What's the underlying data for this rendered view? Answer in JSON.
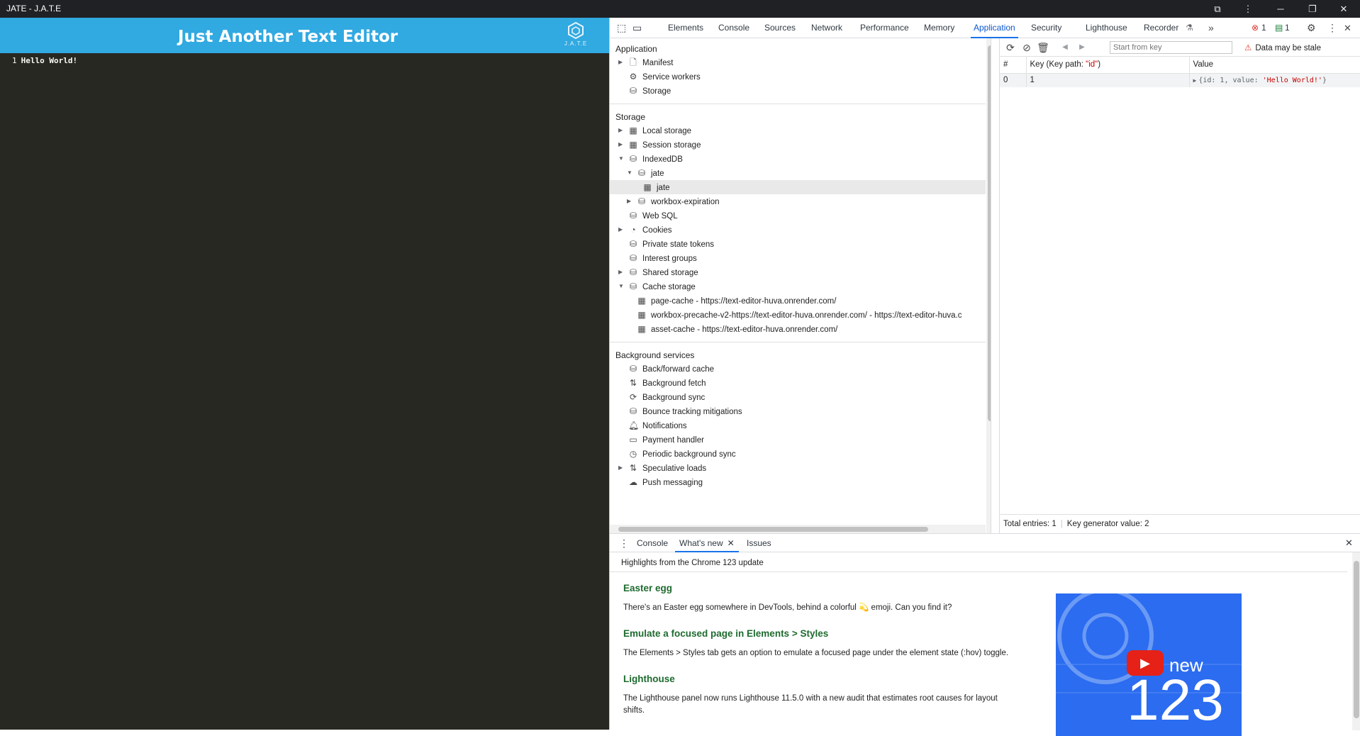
{
  "window": {
    "title": "JATE - J.A.T.E"
  },
  "app": {
    "header_title": "Just Another Text Editor",
    "logo_text": "J.A.T.E",
    "editor_line_number": "1",
    "editor_text": "Hello World!"
  },
  "devtools": {
    "tabs": [
      "Elements",
      "Console",
      "Sources",
      "Network",
      "Performance",
      "Memory",
      "Application",
      "Security",
      "Lighthouse",
      "Recorder"
    ],
    "active_tab": "Application",
    "error_count": "1",
    "message_count": "1",
    "sidebar": {
      "application_header": "Application",
      "application_items": [
        "Manifest",
        "Service workers",
        "Storage"
      ],
      "storage_header": "Storage",
      "storage_items": [
        "Local storage",
        "Session storage",
        "IndexedDB",
        "jate",
        "jate",
        "workbox-expiration",
        "Web SQL",
        "Cookies",
        "Private state tokens",
        "Interest groups",
        "Shared storage",
        "Cache storage",
        "page-cache - https://text-editor-huva.onrender.com/",
        "workbox-precache-v2-https://text-editor-huva.onrender.com/ - https://text-editor-huva.c",
        "asset-cache - https://text-editor-huva.onrender.com/"
      ],
      "background_header": "Background services",
      "background_items": [
        "Back/forward cache",
        "Background fetch",
        "Background sync",
        "Bounce tracking mitigations",
        "Notifications",
        "Payment handler",
        "Periodic background sync",
        "Speculative loads",
        "Push messaging"
      ]
    },
    "db": {
      "key_placeholder": "Start from key",
      "stale_warning": "Data may be stale",
      "col_index": "#",
      "col_key": "Key (Key path: ",
      "col_key_path": "\"id\"",
      "col_key_end": ")",
      "col_value": "Value",
      "row_index": "0",
      "row_key": "1",
      "row_value_prefix": "{id: 1, value: ",
      "row_value_string": "'Hello World!'",
      "row_value_suffix": "}",
      "footer_entries": "Total entries: 1",
      "footer_keygen": "Key generator value: 2"
    },
    "drawer": {
      "tabs": [
        "Console",
        "What's new",
        "Issues"
      ],
      "active_tab": "What's new",
      "highlights": "Highlights from the Chrome 123 update",
      "sections": [
        {
          "title": "Easter egg",
          "body": "There's an Easter egg somewhere in DevTools, behind a colorful 💫 emoji. Can you find it?"
        },
        {
          "title": "Emulate a focused page in Elements > Styles",
          "body": "The Elements > Styles tab gets an option to emulate a focused page under the element state (:hov) toggle."
        },
        {
          "title": "Lighthouse",
          "body": "The Lighthouse panel now runs Lighthouse 11.5.0 with a new audit that estimates root causes for layout shifts."
        }
      ],
      "video_new": "new",
      "video_version": "123"
    }
  }
}
